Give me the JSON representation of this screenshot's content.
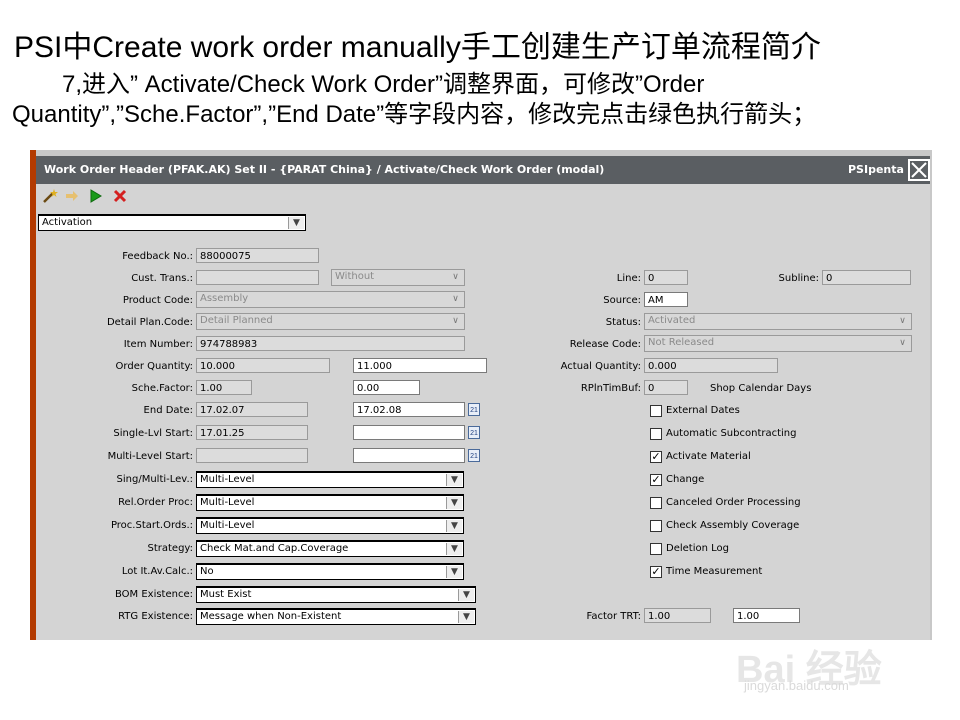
{
  "slide": {
    "title": "PSI中Create work order manually手工创建生产订单流程简介",
    "subtitle_line1": "7,进入” Activate/Check Work Order”调整界面，可修改”Order",
    "subtitle_line2": "Quantity”,”Sche.Factor”,”End Date”等字段内容，修改完点击绿色执行箭头；"
  },
  "window": {
    "title": "Work Order Header  (PFAK.AK)  Set II - {PARAT China} / Activate/Check Work Order (modal)",
    "brand": "PSIpenta",
    "close_icon": "close-icon"
  },
  "toolbar": {
    "icons": [
      "magic-wand-icon",
      "arrow-right-icon",
      "play-icon",
      "cancel-icon"
    ],
    "mode_select": "Activation"
  },
  "left": {
    "feedback_no": {
      "label": "Feedback No.:",
      "value": "88000075"
    },
    "cust_trans": {
      "label": "Cust. Trans.:",
      "value": "",
      "select": "Without"
    },
    "product_code": {
      "label": "Product Code:",
      "value": "Assembly"
    },
    "detail_plan_code": {
      "label": "Detail Plan.Code:",
      "value": "Detail Planned"
    },
    "item_number": {
      "label": "Item Number:",
      "value": "974788983"
    },
    "order_quantity": {
      "label": "Order Quantity:",
      "value": "10.000",
      "new_value": "11.000"
    },
    "sche_factor": {
      "label": "Sche.Factor:",
      "value": "1.00",
      "new_value": "0.00"
    },
    "end_date": {
      "label": "End Date:",
      "value": "17.02.07",
      "new_value": "17.02.08"
    },
    "single_lvl_start": {
      "label": "Single-Lvl Start:",
      "value": "17.01.25",
      "new_value": ""
    },
    "multi_level_start": {
      "label": "Multi-Level Start:",
      "value": "",
      "new_value": ""
    },
    "sing_multi_lev": {
      "label": "Sing/Multi-Lev.:",
      "value": "Multi-Level"
    },
    "rel_order_proc": {
      "label": "Rel.Order Proc:",
      "value": "Multi-Level"
    },
    "proc_start_ords": {
      "label": "Proc.Start.Ords.:",
      "value": "Multi-Level"
    },
    "strategy": {
      "label": "Strategy:",
      "value": "Check Mat.and Cap.Coverage"
    },
    "lot_it_av_calc": {
      "label": "Lot It.Av.Calc.:",
      "value": "No"
    },
    "bom_existence": {
      "label": "BOM Existence:",
      "value": "Must Exist"
    },
    "rtg_existence": {
      "label": "RTG Existence:",
      "value": "Message when Non-Existent"
    }
  },
  "right": {
    "line": {
      "label": "Line:",
      "value": "0"
    },
    "subline": {
      "label": "Subline:",
      "value": "0"
    },
    "source": {
      "label": "Source:",
      "value": "AM"
    },
    "status": {
      "label": "Status:",
      "value": "Activated"
    },
    "release_code": {
      "label": "Release Code:",
      "value": "Not Released"
    },
    "actual_quantity": {
      "label": "Actual Quantity:",
      "value": "0.000"
    },
    "rplntimbuf": {
      "label": "RPlnTimBuf:",
      "value": "0",
      "unit": "Shop Calendar Days"
    },
    "checkboxes": [
      {
        "label": "External Dates",
        "checked": false
      },
      {
        "label": "Automatic Subcontracting",
        "checked": false
      },
      {
        "label": "Activate Material",
        "checked": true
      },
      {
        "label": "Change",
        "checked": true
      },
      {
        "label": "Canceled Order Processing",
        "checked": false
      },
      {
        "label": "Check Assembly Coverage",
        "checked": false
      },
      {
        "label": "Deletion Log",
        "checked": false
      },
      {
        "label": "Time Measurement",
        "checked": true
      }
    ],
    "factor_trt": {
      "label": "Factor TRT:",
      "value": "1.00",
      "new_value": "1.00"
    }
  },
  "watermark": {
    "line1": "Bai 经验",
    "line2": "jingyan.baidu.com"
  },
  "colors": {
    "title_bar": "#5a5e62",
    "window_border": "#b33a00",
    "panel_bg": "#d4d4d4",
    "play_icon": "#1a9a1a",
    "cancel_icon": "#d42020"
  }
}
